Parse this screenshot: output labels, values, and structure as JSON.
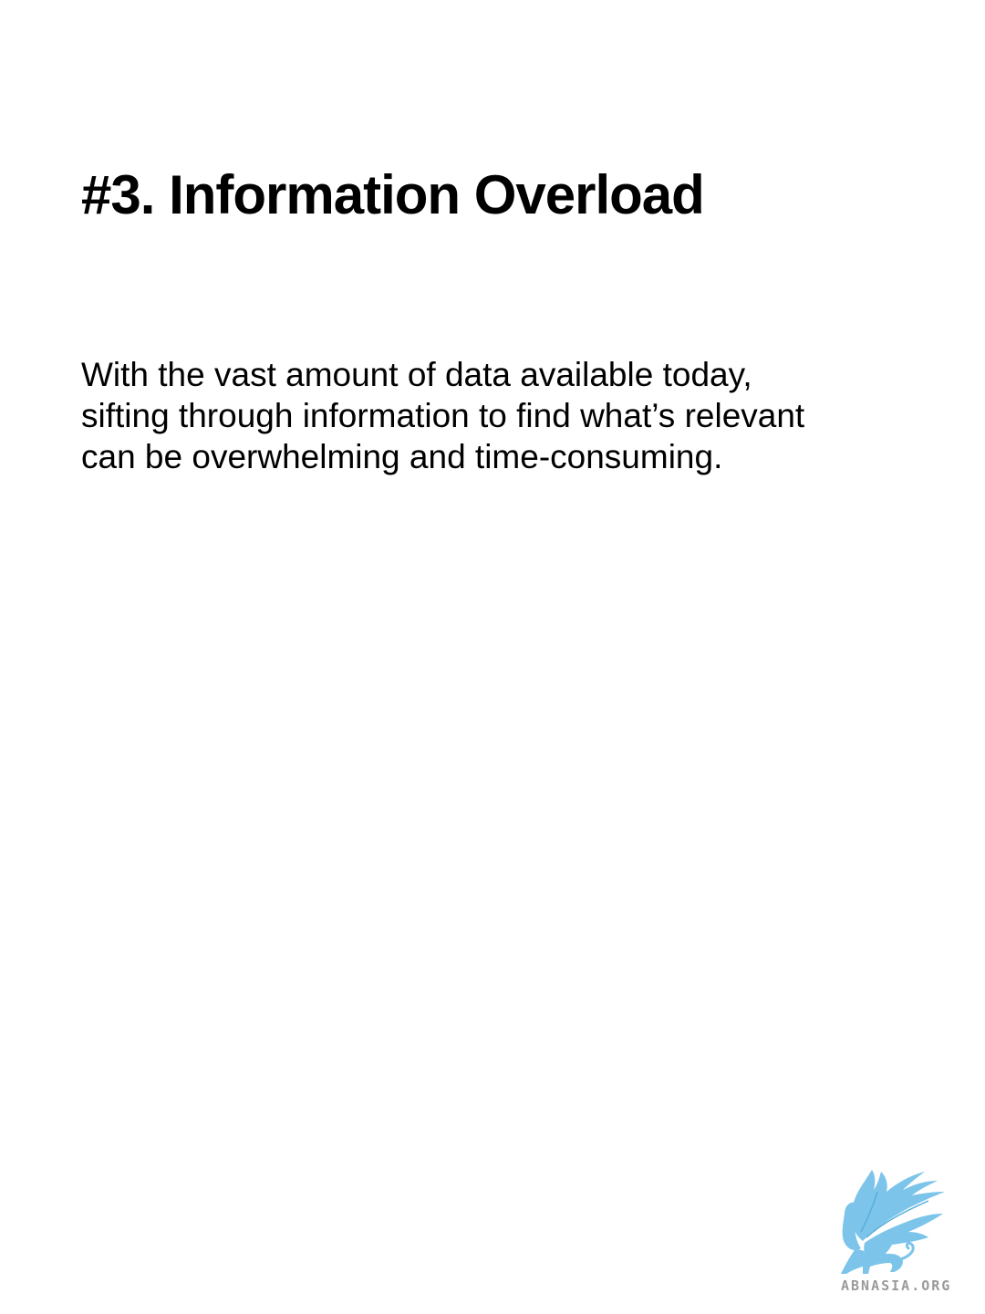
{
  "title": "#3. Information Overload",
  "body": {
    "lines": [
      "With the vast amount of data available today,",
      "sifting through information to find what’s relevant",
      "can be overwhelming and time-consuming."
    ]
  },
  "logo": {
    "icon": "griffin-icon",
    "text": "ABNASIA.ORG",
    "colors": {
      "icon": "#7cc4ea",
      "icon_dark": "#5aaedb",
      "text": "#9a9a9a"
    }
  }
}
